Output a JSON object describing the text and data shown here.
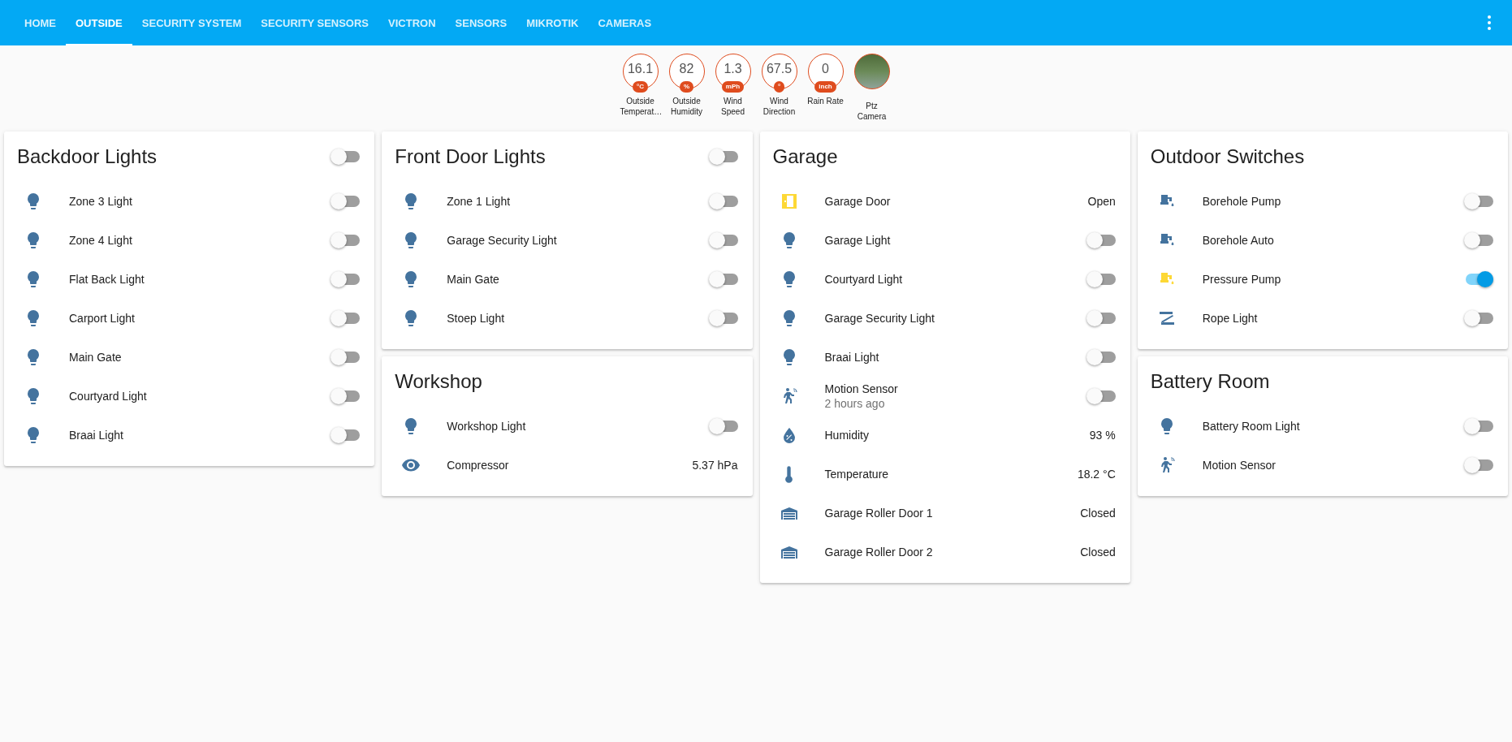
{
  "tabs": [
    {
      "label": "HOME",
      "selected": false
    },
    {
      "label": "OUTSIDE",
      "selected": true
    },
    {
      "label": "SECURITY SYSTEM",
      "selected": false
    },
    {
      "label": "SECURITY SENSORS",
      "selected": false
    },
    {
      "label": "VICTRON",
      "selected": false
    },
    {
      "label": "SENSORS",
      "selected": false
    },
    {
      "label": "MIKROTIK",
      "selected": false
    },
    {
      "label": "CAMERAS",
      "selected": false
    }
  ],
  "badges": [
    {
      "kind": "sensor",
      "value": "16.1",
      "unit": "°C",
      "label": "Outside Temperat…"
    },
    {
      "kind": "sensor",
      "value": "82",
      "unit": "%",
      "label": "Outside Humidity"
    },
    {
      "kind": "sensor",
      "value": "1.3",
      "unit": "mPh",
      "label": "Wind Speed"
    },
    {
      "kind": "sensor",
      "value": "67.5",
      "unit": "°",
      "label": "Wind Direction"
    },
    {
      "kind": "sensor",
      "value": "0",
      "unit": "inch",
      "label": "Rain Rate"
    },
    {
      "kind": "camera",
      "label": "Ptz Camera"
    }
  ],
  "columns": [
    {
      "cards": [
        {
          "title": "Backdoor Lights",
          "on": false,
          "rows": [
            {
              "kind": "light",
              "name": "Zone 3 Light",
              "on": false
            },
            {
              "kind": "light",
              "name": "Zone 4 Light",
              "on": false
            },
            {
              "kind": "light",
              "name": "Flat Back Light",
              "on": false
            },
            {
              "kind": "light",
              "name": "Carport Light",
              "on": false
            },
            {
              "kind": "light",
              "name": "Main Gate",
              "on": false
            },
            {
              "kind": "light",
              "name": "Courtyard Light",
              "on": false
            },
            {
              "kind": "light",
              "name": "Braai Light",
              "on": false
            }
          ]
        }
      ]
    },
    {
      "cards": [
        {
          "title": "Front Door Lights",
          "on": false,
          "rows": [
            {
              "kind": "light",
              "name": "Zone 1 Light",
              "on": false
            },
            {
              "kind": "light",
              "name": "Garage Security Light",
              "on": false
            },
            {
              "kind": "light",
              "name": "Main Gate",
              "on": false
            },
            {
              "kind": "light",
              "name": "Stoep Light",
              "on": false
            }
          ]
        },
        {
          "title": "Workshop",
          "rows": [
            {
              "kind": "light",
              "name": "Workshop Light",
              "on": false
            },
            {
              "kind": "eye",
              "name": "Compressor",
              "value": "5.37 hPa",
              "active": false
            }
          ]
        }
      ]
    },
    {
      "cards": [
        {
          "title": "Garage",
          "rows": [
            {
              "kind": "door",
              "name": "Garage Door",
              "value": "Open",
              "active": true
            },
            {
              "kind": "light",
              "name": "Garage Light",
              "on": false
            },
            {
              "kind": "light",
              "name": "Courtyard Light",
              "on": false
            },
            {
              "kind": "light",
              "name": "Garage Security Light",
              "on": false
            },
            {
              "kind": "light",
              "name": "Braai Light",
              "on": false
            },
            {
              "kind": "motion",
              "name": "Motion Sensor",
              "secondary": "2 hours ago",
              "on": false
            },
            {
              "kind": "humidity",
              "name": "Humidity",
              "value": "93 %",
              "active": false
            },
            {
              "kind": "thermometer",
              "name": "Temperature",
              "value": "18.2 °C",
              "active": false
            },
            {
              "kind": "garage",
              "name": "Garage Roller Door 1",
              "value": "Closed",
              "active": false
            },
            {
              "kind": "garage",
              "name": "Garage Roller Door 2",
              "value": "Closed",
              "active": false
            }
          ]
        }
      ]
    },
    {
      "cards": [
        {
          "title": "Outdoor Switches",
          "rows": [
            {
              "kind": "pump",
              "name": "Borehole Pump",
              "on": false
            },
            {
              "kind": "pump",
              "name": "Borehole Auto",
              "on": false
            },
            {
              "kind": "pump",
              "name": "Pressure Pump",
              "on": true
            },
            {
              "kind": "rope",
              "name": "Rope Light",
              "on": false
            }
          ]
        },
        {
          "title": "Battery Room",
          "rows": [
            {
              "kind": "light",
              "name": "Battery Room Light",
              "on": false
            },
            {
              "kind": "motion",
              "name": "Motion Sensor",
              "on": false
            }
          ]
        }
      ]
    }
  ]
}
